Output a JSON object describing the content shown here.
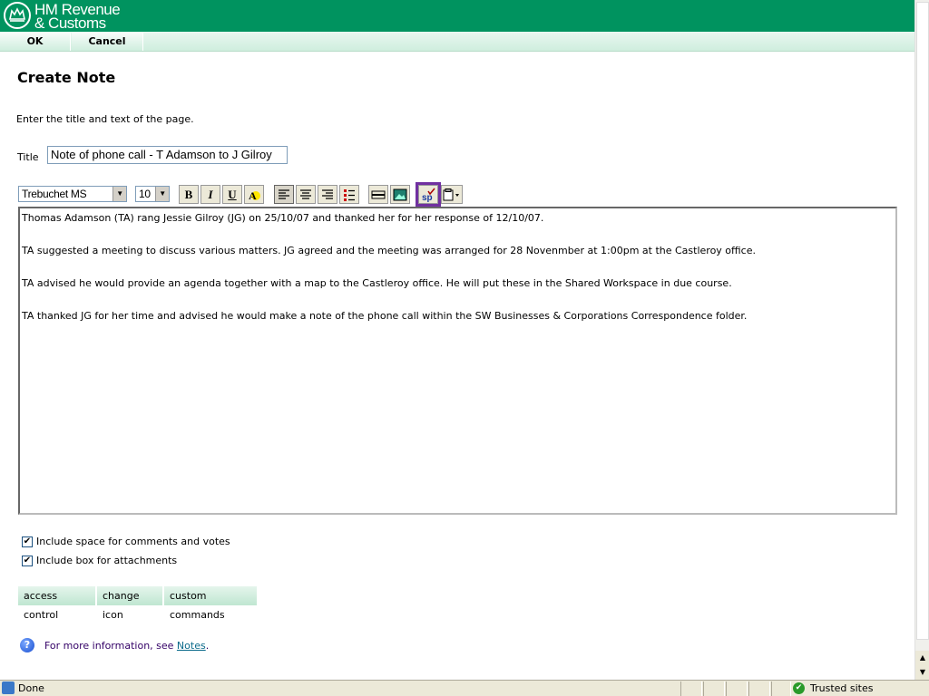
{
  "header": {
    "logo_line1": "HM Revenue",
    "logo_line2": "& Customs",
    "brand_color": "#00935f"
  },
  "topbar": {
    "ok_label": "OK",
    "cancel_label": "Cancel"
  },
  "page": {
    "title": "Create Note",
    "intro": "Enter the title and text of the page.",
    "title_label": "Title",
    "title_value": "Note of phone call - T Adamson to J Gilroy"
  },
  "toolbar": {
    "font": "Trebuchet MS",
    "size": "10",
    "bold": "B",
    "italic": "I",
    "underline": "U",
    "icons": [
      "font-color-icon",
      "align-left-icon",
      "align-center-icon",
      "align-right-icon",
      "bulleted-list-icon",
      "horizontal-rule-icon",
      "insert-image-icon",
      "spell-check-icon",
      "paste-icon"
    ]
  },
  "editor": {
    "paragraphs": [
      "Thomas Adamson (TA) rang Jessie Gilroy (JG) on 25/10/07 and thanked her for her response of 12/10/07.",
      "TA suggested a meeting to discuss various matters. JG agreed and the meeting was arranged for 28 Novenmber at 1:00pm at the Castleroy office.",
      "TA advised he would provide an agenda together with a map to the Castleroy office. He will put these in the Shared Workspace in due course.",
      "TA thanked JG for her time and advised he would make a note of the phone call within the SW Businesses & Corporations Correspondence folder."
    ]
  },
  "options": {
    "comments_label": "Include space for comments and votes",
    "attachments_label": "Include box for attachments",
    "comments_checked": true,
    "attachments_checked": true
  },
  "actions": {
    "access_control": "access control",
    "change_icon": "change icon",
    "custom_commands": "custom commands"
  },
  "info": {
    "prefix": "For more information, see ",
    "link": "Notes",
    "suffix": "."
  },
  "status": {
    "text": "Done",
    "zone": "Trusted sites"
  }
}
